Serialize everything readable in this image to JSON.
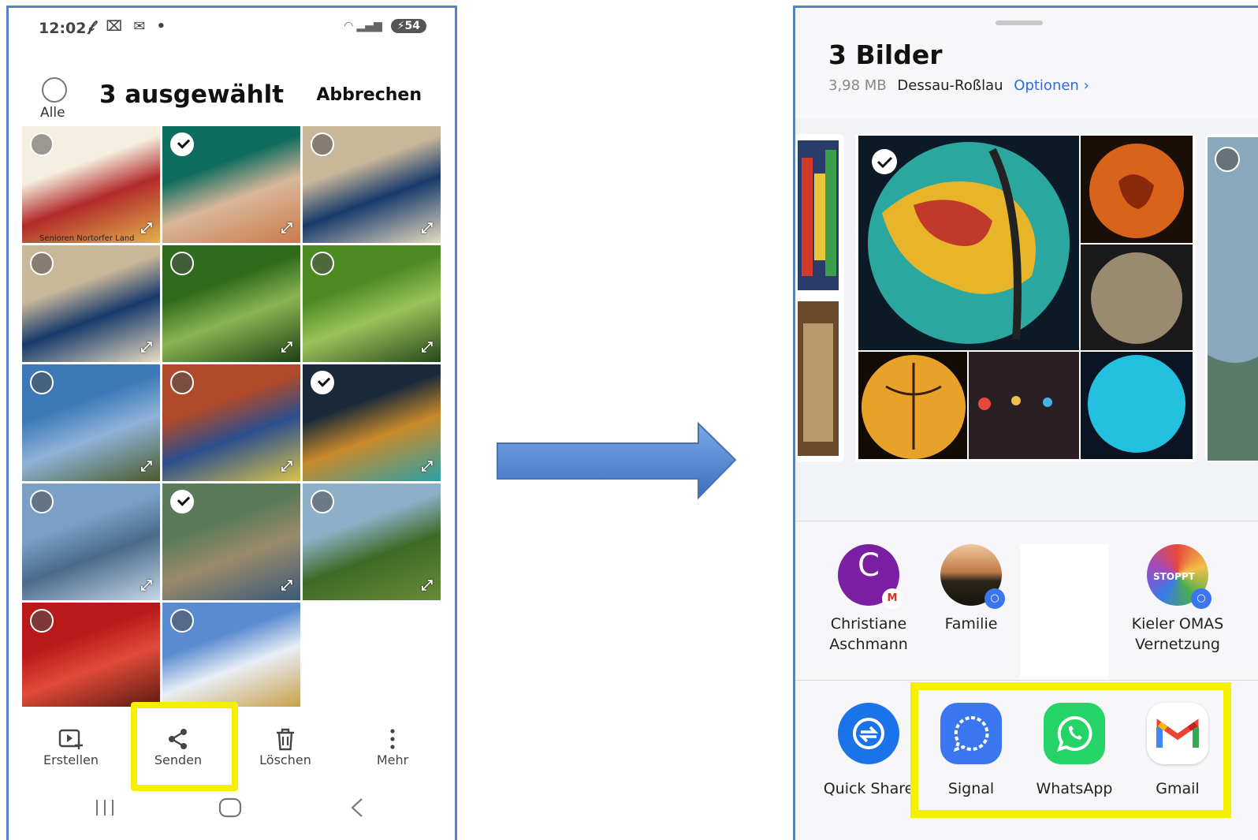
{
  "left": {
    "status": {
      "time": "12:02",
      "battery": "54"
    },
    "header": {
      "all_label": "Alle",
      "title": "3 ausgewählt",
      "cancel": "Abbrechen"
    },
    "tiles": [
      {
        "selected": false,
        "colors": [
          "#f4efe0",
          "#b22a2a",
          "#e2b24c"
        ],
        "overlay": "Senioren Nortorfer Land"
      },
      {
        "selected": true,
        "colors": [
          "#0f6d5e",
          "#d9b79a",
          "#c97a4a"
        ]
      },
      {
        "selected": false,
        "colors": [
          "#c9b79a",
          "#173a6b",
          "#e8dcc0"
        ]
      },
      {
        "selected": false,
        "colors": [
          "#c9b79a",
          "#173a6b",
          "#e8dcc0"
        ]
      },
      {
        "selected": false,
        "colors": [
          "#2f6b1c",
          "#8bb452",
          "#1e3f14"
        ]
      },
      {
        "selected": false,
        "colors": [
          "#4c8a22",
          "#9bc25a",
          "#26481a"
        ]
      },
      {
        "selected": false,
        "colors": [
          "#3d79b8",
          "#8fb3d8",
          "#4a5a2a"
        ]
      },
      {
        "selected": false,
        "colors": [
          "#b04a2a",
          "#2c4e8e",
          "#d9c34a"
        ]
      },
      {
        "selected": true,
        "colors": [
          "#1a2a3a",
          "#c98a2a",
          "#2aa0a8"
        ]
      },
      {
        "selected": false,
        "colors": [
          "#7aa0c8",
          "#4a6a8a",
          "#c6d7e6"
        ]
      },
      {
        "selected": true,
        "colors": [
          "#5a7a5a",
          "#9a8a6a",
          "#3a5a7a"
        ]
      },
      {
        "selected": false,
        "colors": [
          "#8db0c8",
          "#3e6a26",
          "#6a8a3a"
        ]
      },
      {
        "selected": false,
        "colors": [
          "#b81a1a",
          "#e04a3a",
          "#5a1a10"
        ]
      },
      {
        "selected": false,
        "colors": [
          "#5a8ad0",
          "#e8eef6",
          "#c8a04a"
        ]
      }
    ],
    "actions": [
      {
        "label": "Erstellen",
        "icon": "create-icon"
      },
      {
        "label": "Senden",
        "icon": "share-icon"
      },
      {
        "label": "Löschen",
        "icon": "trash-icon"
      },
      {
        "label": "Mehr",
        "icon": "more-icon"
      }
    ],
    "highlight_color": "#f5f000"
  },
  "right": {
    "title": "3 Bilder",
    "size": "3,98 MB",
    "place": "Dessau-Roßlau",
    "options": "Optionen",
    "contacts": [
      {
        "name_line1": "Christiane",
        "name_line2": "Aschmann",
        "avatar_letter": "C",
        "avatar_color": "#7b1fa2",
        "badge": "gmail"
      },
      {
        "name_line1": "Familie",
        "name_line2": "",
        "avatar_letter": "",
        "avatar_color": "#3a3320",
        "badge": "signal"
      },
      {
        "name_line1": "",
        "name_line2": "",
        "avatar_letter": "",
        "avatar_color": "#ffffff",
        "badge": ""
      },
      {
        "name_line1": "Kieler OMAS",
        "name_line2": "Vernetzung",
        "avatar_letter": "",
        "avatar_color": "#c93a6a",
        "badge": "signal"
      }
    ],
    "apps": [
      {
        "label": "Quick Share",
        "icon": "quick-share-icon",
        "color": "#1a73e8"
      },
      {
        "label": "Signal",
        "icon": "signal-icon",
        "color": "#3a76f0"
      },
      {
        "label": "WhatsApp",
        "icon": "whatsapp-icon",
        "color": "#25d366"
      },
      {
        "label": "Gmail",
        "icon": "gmail-icon",
        "color": "#ffffff"
      }
    ],
    "highlight_color": "#f5f000"
  },
  "arrow_color": "#5b8fd6"
}
